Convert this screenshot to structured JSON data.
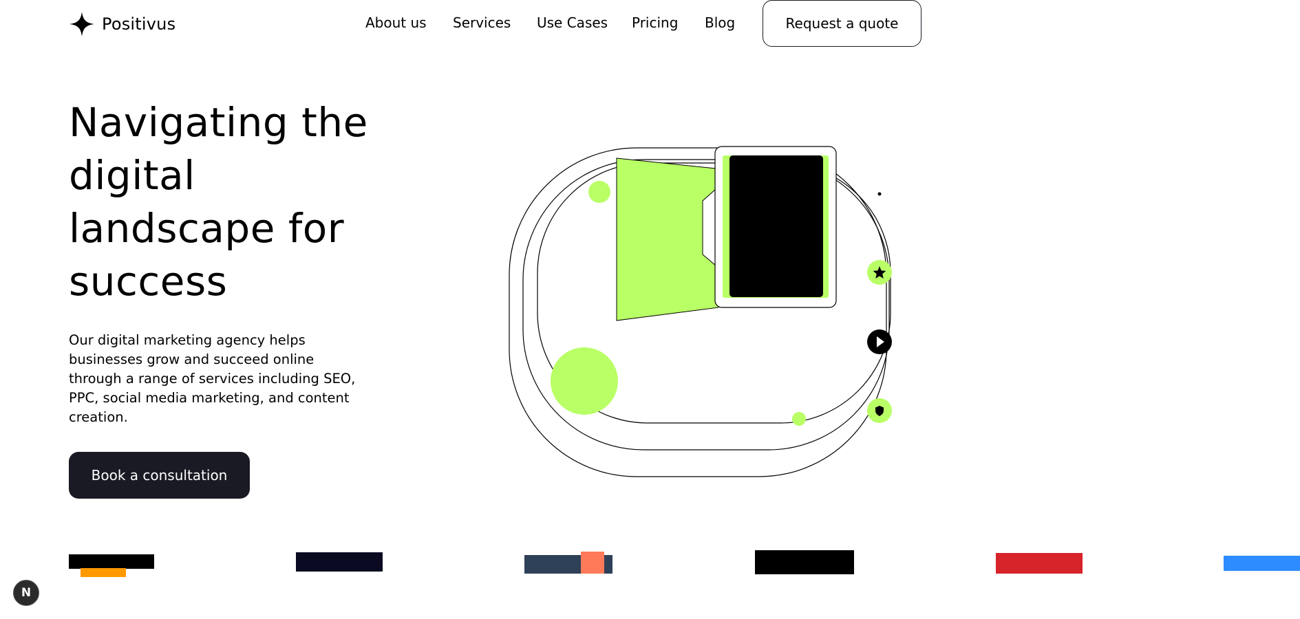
{
  "brand": {
    "name": "Positivus",
    "icon": "sparkle-star-icon"
  },
  "nav": {
    "links": [
      "About us",
      "Services",
      "Use Cases",
      "Pricing",
      "Blog"
    ],
    "cta_label": "Request a quote"
  },
  "hero": {
    "title": "Navigating the digital landscape for success",
    "description": "Our digital marketing agency helps businesses grow and succeed online through a range of services including SEO, PPC, social media marketing, and content creation.",
    "cta_label": "Book a consultation"
  },
  "illustration": {
    "icons": [
      "star-icon",
      "play-icon",
      "shield-icon"
    ],
    "colors": {
      "accent": "#B9FF66",
      "dark": "#000000"
    }
  },
  "logos": [
    {
      "name": "logo-1",
      "colors": [
        "#000000",
        "#FF9900"
      ]
    },
    {
      "name": "logo-2",
      "colors": [
        "#0A0A23"
      ]
    },
    {
      "name": "logo-3",
      "colors": [
        "#2F4158",
        "#FF7A59"
      ]
    },
    {
      "name": "logo-4",
      "colors": [
        "#000000"
      ]
    },
    {
      "name": "logo-5",
      "colors": [
        "#D7232A"
      ]
    },
    {
      "name": "logo-6",
      "colors": [
        "#2D8CFF"
      ]
    }
  ],
  "dev_badge": {
    "label": "N"
  },
  "colors": {
    "accent": "#B9FF66",
    "dark": "#191A23",
    "background": "#FFFFFF"
  }
}
